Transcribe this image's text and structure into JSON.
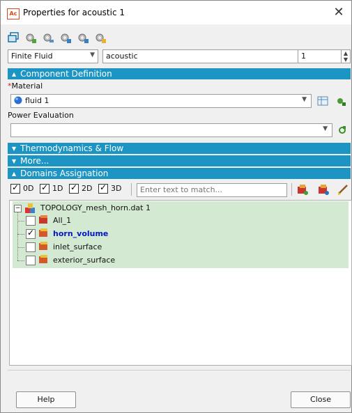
{
  "window": {
    "app_badge": "Ac",
    "title": "Properties for acoustic 1",
    "close_glyph": "✕"
  },
  "toolbar": {
    "icons": [
      "window-icon",
      "gear-add-icon",
      "gear-remove-icon",
      "gear-copy-icon",
      "gear-link-icon",
      "gear-edit-icon"
    ]
  },
  "header_row": {
    "type_value": "Finite Fluid",
    "name_value": "acoustic",
    "index_value": "1"
  },
  "sections": {
    "component_definition": "Component Definition",
    "thermodynamics": "Thermodynamics & Flow",
    "more": "More...",
    "domains": "Domains Assignation"
  },
  "material": {
    "required_mark": "*",
    "label": "Material",
    "value": "fluid 1"
  },
  "power": {
    "label": "Power Evaluation",
    "value": ""
  },
  "filters": {
    "d0": "0D",
    "d1": "1D",
    "d2": "2D",
    "d3": "3D",
    "search_placeholder": "Enter text to match..."
  },
  "tree": {
    "root_label": "TOPOLOGY_mesh_horn.dat 1",
    "items": [
      {
        "label": "All_1",
        "checked": false
      },
      {
        "label": "horn_volume",
        "checked": true
      },
      {
        "label": "inlet_surface",
        "checked": false
      },
      {
        "label": "exterior_surface",
        "checked": false
      }
    ]
  },
  "footer": {
    "help": "Help",
    "close": "Close"
  },
  "colors": {
    "section_bar": "#1d95c4",
    "tree_highlight": "#d3e9d2",
    "selected_text": "#0018c8"
  }
}
